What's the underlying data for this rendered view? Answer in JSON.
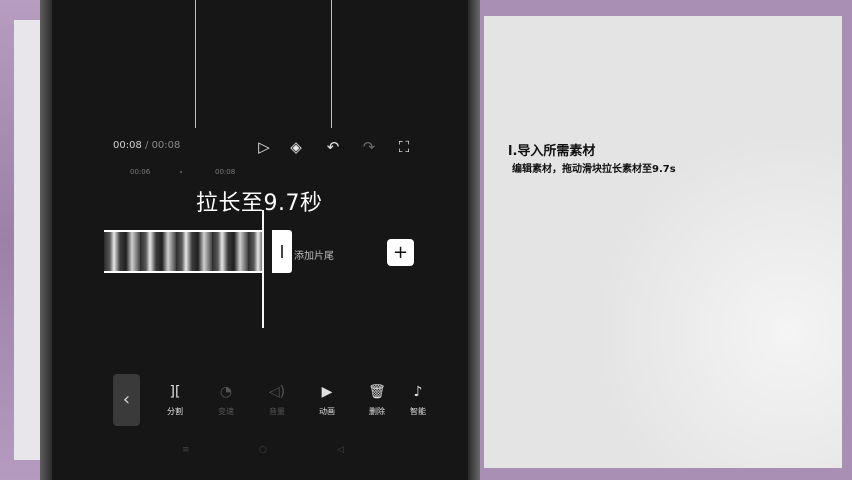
{
  "editor": {
    "time_current": "00:08",
    "time_separator": " / ",
    "time_total": "00:08",
    "controls": [
      {
        "name": "play-icon",
        "glyph": "▷"
      },
      {
        "name": "keyframe-icon",
        "glyph": "◈"
      },
      {
        "name": "undo-icon",
        "glyph": "↶"
      },
      {
        "name": "redo-icon",
        "glyph": "↷"
      },
      {
        "name": "fullscreen-icon",
        "glyph": "⛶"
      }
    ],
    "ruler": {
      "mark1": "00:06",
      "mark2": "00:08"
    },
    "caption": "拉长至9.7秒",
    "add_end_label": "添加片尾",
    "add_button": "+",
    "back_glyph": "‹",
    "tools": [
      {
        "icon": "split-icon",
        "glyph": "][",
        "label": "分割"
      },
      {
        "icon": "speed-icon",
        "glyph": "◔",
        "label": "变速"
      },
      {
        "icon": "volume-icon",
        "glyph": "◁)",
        "label": "音量"
      },
      {
        "icon": "animation-icon",
        "glyph": "▶",
        "label": "动画"
      },
      {
        "icon": "delete-icon",
        "glyph": "🗑",
        "label": "删除"
      },
      {
        "icon": "smart-icon",
        "glyph": "♪",
        "label": "智能"
      }
    ],
    "navbar": {
      "menu": "≡",
      "home": "○",
      "back": "◁"
    }
  },
  "doc": {
    "title": "l.导入所需素材",
    "body": "编辑素材，拖动滑块拉长素材至9.7s"
  }
}
